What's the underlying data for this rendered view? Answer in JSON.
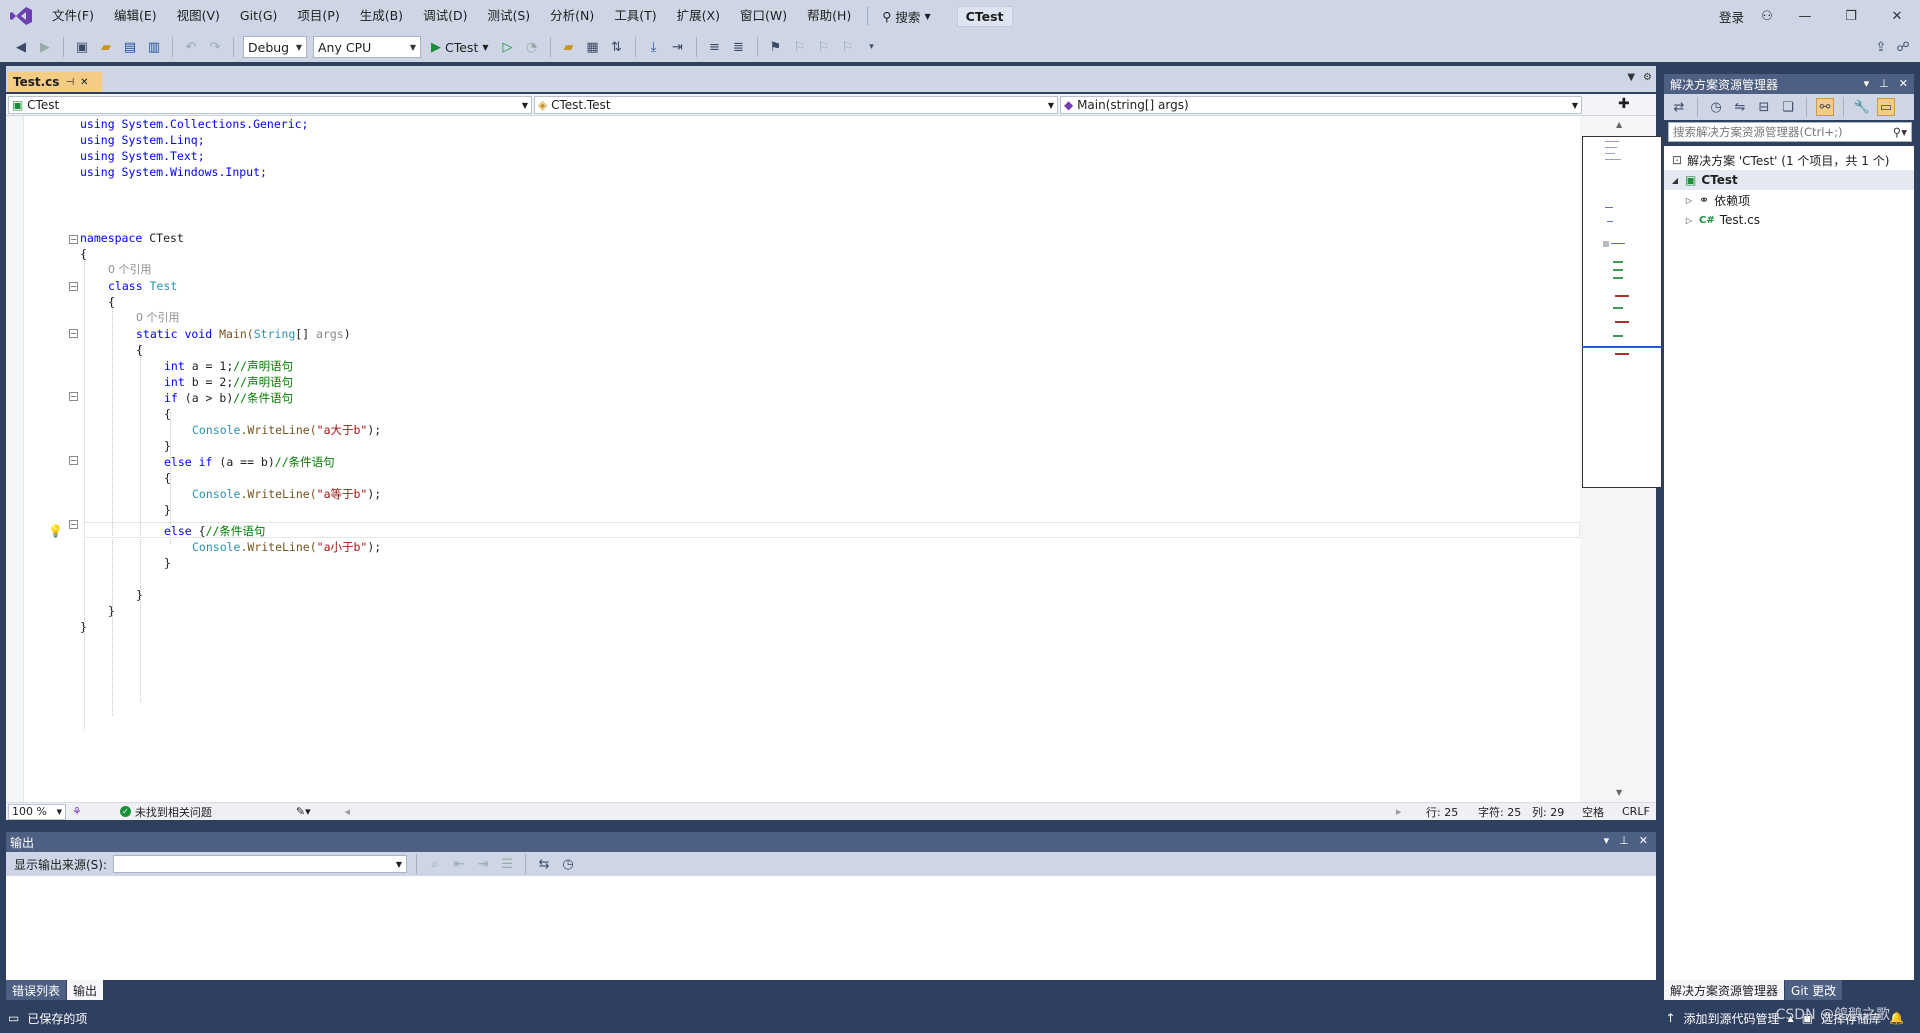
{
  "menubar": {
    "items": [
      "文件(F)",
      "编辑(E)",
      "视图(V)",
      "Git(G)",
      "项目(P)",
      "生成(B)",
      "调试(D)",
      "测试(S)",
      "分析(N)",
      "工具(T)",
      "扩展(X)",
      "窗口(W)",
      "帮助(H)"
    ],
    "search_label": "搜索",
    "solution_title": "CTest",
    "login_label": "登录"
  },
  "toolbar": {
    "configuration": "Debug",
    "platform": "Any CPU",
    "run_target": "CTest"
  },
  "document": {
    "tab_name": "Test.cs",
    "nav_project": "CTest",
    "nav_type": "CTest.Test",
    "nav_member": "Main(string[] args)"
  },
  "code": {
    "using1": "using System.Collections.Generic;",
    "using2": "using System.Linq;",
    "using3": "using System.Text;",
    "using4": "using System.Windows.Input;",
    "namespace_kw": "namespace",
    "namespace_name": " CTest",
    "brace_open": "{",
    "brace_close": "}",
    "refs_class": "0 个引用",
    "class_kw": "class",
    "class_name": " Test",
    "refs_main": "0 个引用",
    "main_static_void": "static void",
    "main_name": " Main(",
    "main_param_type": "String",
    "main_param_rest": "[] ",
    "main_param_name": "args",
    "main_close": ")",
    "line_int_a_kw": "int",
    "line_int_a_rest": " a = 1;",
    "line_int_a_cm": "//声明语句",
    "line_int_b_kw": "int",
    "line_int_b_rest": " b = 2;",
    "line_int_b_cm": "//声明语句",
    "line_if_kw": "if",
    "line_if_rest": " (a > b)",
    "line_if_cm": "//条件语句",
    "console1_type": "Console",
    "console1_method": ".WriteLine(",
    "console1_str": "\"a大于b\"",
    "console1_end": ");",
    "line_elseif_kw": "else if",
    "line_elseif_rest": " (a == b)",
    "line_elseif_cm": "//条件语句",
    "console2_type": "Console",
    "console2_method": ".WriteLine(",
    "console2_str": "\"a等于b\"",
    "console2_end": ");",
    "line_else_kw": "else",
    "line_else_rest": " {",
    "line_else_cm": "//条件语句",
    "console3_type": "Console",
    "console3_method": ".WriteLine(",
    "console3_str": "\"a小于b\"",
    "console3_end": ");"
  },
  "editor_status": {
    "zoom": "100 %",
    "issues": "未找到相关问题",
    "line": "行: 25",
    "char": "字符: 25",
    "col": "列: 29",
    "whitespace": "空格",
    "line_ending": "CRLF"
  },
  "output": {
    "title": "输出",
    "source_label": "显示输出来源(S):",
    "source_value": ""
  },
  "bottom_tabs": {
    "error_list": "错误列表",
    "output": "输出"
  },
  "solution_explorer": {
    "title": "解决方案资源管理器",
    "search_placeholder": "搜索解决方案资源管理器(Ctrl+;)",
    "solution_node": "解决方案 'CTest' (1 个项目，共 1 个)",
    "project_node": "CTest",
    "deps_node": "依赖项",
    "file_node": "Test.cs",
    "file_icon_text": "C#",
    "tab_explorer": "解决方案资源管理器",
    "tab_git": "Git 更改"
  },
  "statusbar": {
    "saved": "已保存的项",
    "add_source_control": "添加到源代码管理",
    "select_repo": "选择存储库"
  },
  "watermark": "CSDN @鸽鹅之歌"
}
